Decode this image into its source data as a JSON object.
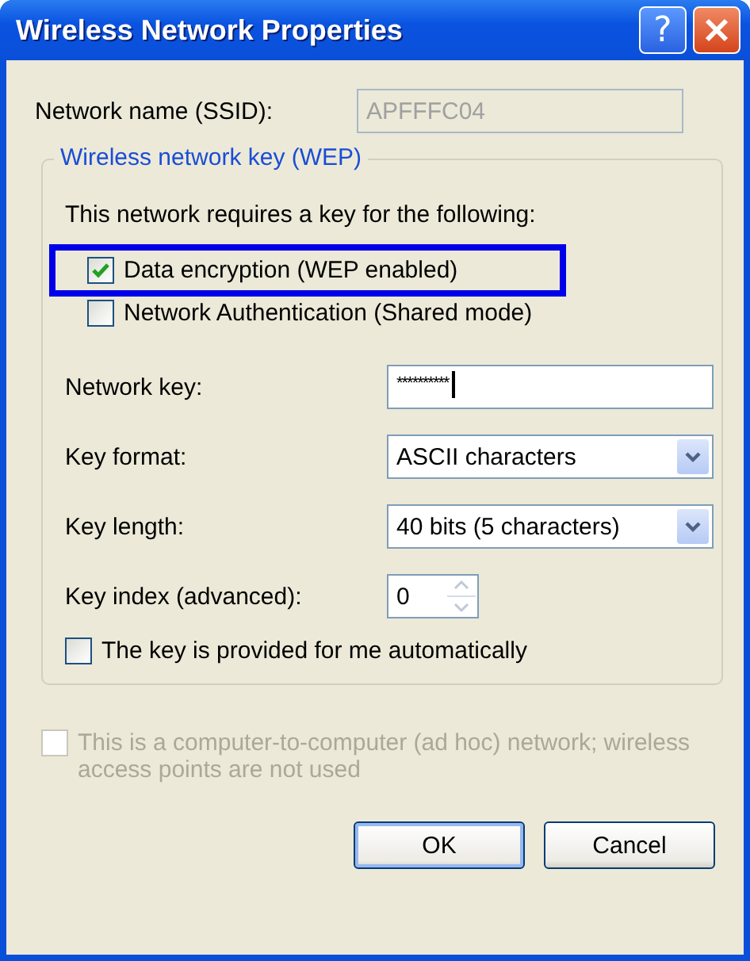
{
  "window": {
    "title": "Wireless Network Properties",
    "help_button": "?"
  },
  "ssid": {
    "label": "Network name (SSID):",
    "value": "APFFFC04",
    "disabled": true
  },
  "key_group": {
    "title": "Wireless network key (WEP)",
    "intro": "This network requires a key for the following:",
    "options": [
      {
        "label": "Data encryption (WEP enabled)",
        "checked": true,
        "highlighted": true
      },
      {
        "label": "Network Authentication (Shared mode)",
        "checked": false,
        "highlighted": false
      }
    ],
    "fields": [
      {
        "kind": "text",
        "label": "Network key:",
        "value": "**********",
        "focused": true
      },
      {
        "kind": "dropdown",
        "label": "Key format:",
        "value": "ASCII characters"
      },
      {
        "kind": "dropdown",
        "label": "Key length:",
        "value": "40 bits (5 characters)"
      },
      {
        "kind": "spinner",
        "label": "Key index (advanced):",
        "value": "0"
      }
    ],
    "auto_key": {
      "label": "The key is provided for me automatically",
      "checked": false
    }
  },
  "adhoc": {
    "label": "This is a computer-to-computer (ad hoc) network; wireless access points are not used",
    "checked": false,
    "disabled": true
  },
  "buttons": [
    {
      "label": "OK",
      "default": true
    },
    {
      "label": "Cancel",
      "default": false
    }
  ]
}
